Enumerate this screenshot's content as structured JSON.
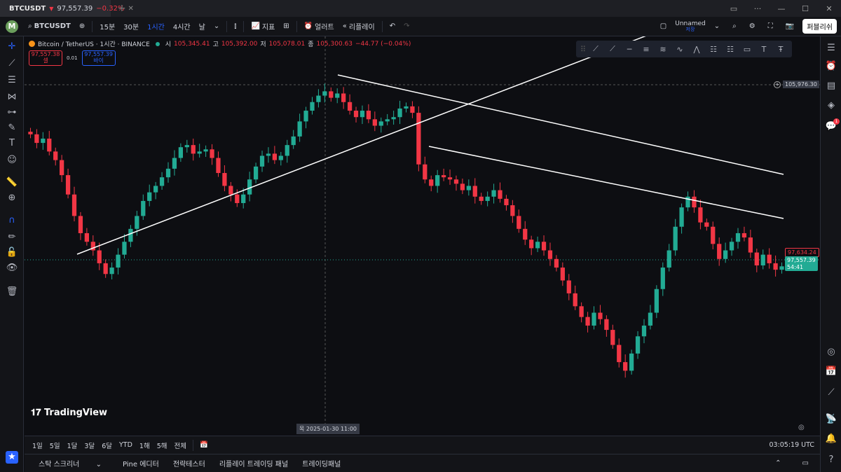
{
  "tab": {
    "symbol": "BTCUSDT",
    "price": "97,557.39",
    "change": "−0.32%"
  },
  "toolbar": {
    "avatar": "M",
    "symbol": "BTCUSDT",
    "intervals": [
      "15분",
      "30분",
      "1시간",
      "4시간",
      "날"
    ],
    "selected_interval": "1시간",
    "indicators": "지표",
    "alert": "얼러트",
    "replay": "리플레이",
    "layout_name": "Unnamed",
    "layout_status": "저장",
    "publish": "퍼블리쉬"
  },
  "legend": {
    "title": "Bitcoin / TetherUS · 1시간 · BINANCE",
    "o_label": "시",
    "o": "105,345.41",
    "h_label": "고",
    "h": "105,392.00",
    "l_label": "저",
    "l": "105,078.01",
    "c_label": "종",
    "c": "105,300.63",
    "chg": "−44.77 (−0.04%)"
  },
  "trade": {
    "sell_price": "97,557.38",
    "sell_label": "셀",
    "spread": "0.01",
    "buy_price": "97,557.39",
    "buy_label": "바이"
  },
  "price_scale": {
    "crosshair_price": "105,976.30",
    "last_price": "97,557.39",
    "countdown": "54:41",
    "alt_price": "97,634.24"
  },
  "crosshair_time": "목 2025-01-30   11:00",
  "brand": "TradingView",
  "ranges": [
    "1일",
    "5일",
    "1달",
    "3달",
    "6달",
    "YTD",
    "1해",
    "5해",
    "전체"
  ],
  "clock": "03:05:19 UTC",
  "panels": [
    "스탁 스크리너",
    "Pine 에디터",
    "전략테스터",
    "리플레이 트레이딩 패널",
    "트레이딩패널"
  ],
  "notification_count": "1",
  "colors": {
    "up": "#22ab94",
    "down": "#f23645",
    "bg": "#0d0e12",
    "accent": "#2962ff"
  },
  "chart_data": {
    "type": "candlestick",
    "symbol": "BTCUSDT",
    "exchange": "BINANCE",
    "interval": "1h",
    "last": 97557.39,
    "closes": [
      103700,
      103300,
      103500,
      102900,
      102500,
      101800,
      100900,
      99900,
      99100,
      98700,
      98300,
      97700,
      97200,
      97500,
      98100,
      98700,
      99300,
      99900,
      100600,
      101000,
      101300,
      101700,
      102100,
      102600,
      103100,
      103200,
      102800,
      102900,
      103000,
      102600,
      101900,
      101300,
      100900,
      100500,
      100900,
      101600,
      102200,
      102700,
      102800,
      102500,
      102700,
      103200,
      103600,
      104300,
      104800,
      105200,
      105500,
      105700,
      105400,
      105600,
      105200,
      104800,
      104500,
      104800,
      104400,
      104100,
      104300,
      104400,
      104500,
      104900,
      105000,
      104700,
      102300,
      101600,
      101300,
      101800,
      101700,
      101600,
      101400,
      101100,
      101300,
      100800,
      100600,
      100800,
      101100,
      100700,
      100400,
      99900,
      99300,
      98800,
      98400,
      98700,
      98300,
      97900,
      97500,
      96900,
      96300,
      95700,
      95200,
      94800,
      95400,
      95100,
      94600,
      93900,
      93100,
      92700,
      93500,
      94300,
      94800,
      95400,
      96500,
      97500,
      98300,
      99400,
      100300,
      100800,
      100300,
      99600,
      99400,
      98600,
      97900,
      98300,
      98700,
      99100,
      98900,
      98200,
      97600,
      98100,
      97700,
      97400,
      97557
    ]
  }
}
